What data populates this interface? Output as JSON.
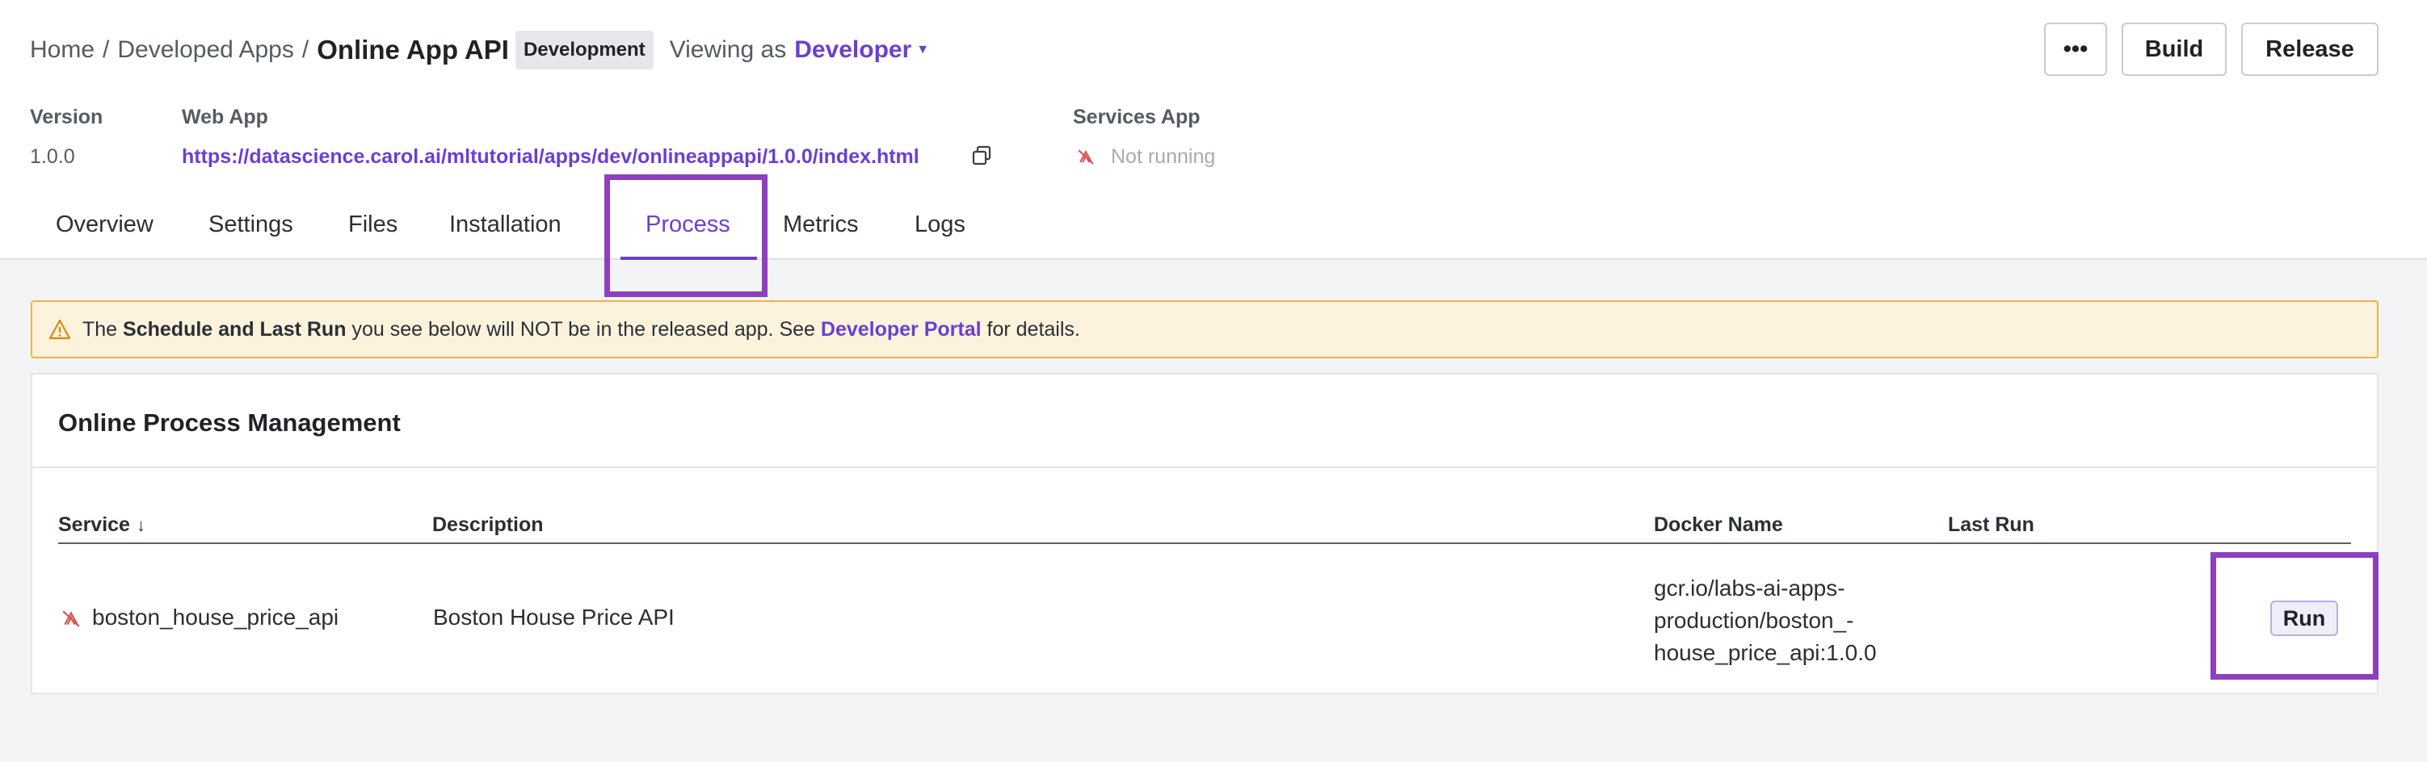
{
  "breadcrumb": {
    "home": "Home",
    "separator": "/",
    "apps": "Developed Apps",
    "current": "Online App API",
    "badge": "Development",
    "viewing_label": "Viewing as",
    "role": "Developer"
  },
  "actions": {
    "more": "•••",
    "build": "Build",
    "release": "Release"
  },
  "meta": {
    "version_label": "Version",
    "version_value": "1.0.0",
    "webapp_label": "Web App",
    "webapp_url": "https://datascience.carol.ai/mltutorial/apps/dev/onlineappapi/1.0.0/index.html",
    "services_label": "Services App",
    "services_status": "Not running"
  },
  "tabs": [
    "Overview",
    "Settings",
    "Files",
    "Installation",
    "Process",
    "Metrics",
    "Logs"
  ],
  "active_tab": "Process",
  "warning": {
    "prefix": "The",
    "bold": "Schedule and Last Run",
    "middle": "you see below will NOT be in the released app. See",
    "link": "Developer Portal",
    "suffix": "for details."
  },
  "process": {
    "title": "Online Process Management",
    "columns": {
      "service": "Service",
      "sort_icon": "↓",
      "description": "Description",
      "docker": "Docker Name",
      "last_run": "Last Run"
    },
    "rows": [
      {
        "service": "boston_house_price_api",
        "description": "Boston House Price API",
        "docker": "gcr.io/labs-ai-apps-production/boston_-house_price_api:1.0.0",
        "last_run": "",
        "action": "Run"
      }
    ]
  },
  "colors": {
    "accent": "#6b3fd1",
    "highlight": "#8e3fc0",
    "warning_bg": "#fdf3dd",
    "warning_border": "#f2b24a",
    "stopped": "#d9534f"
  },
  "icons": [
    "copy-icon",
    "service-stopped-icon",
    "warning-icon",
    "caret-down-icon",
    "sort-down-icon"
  ]
}
